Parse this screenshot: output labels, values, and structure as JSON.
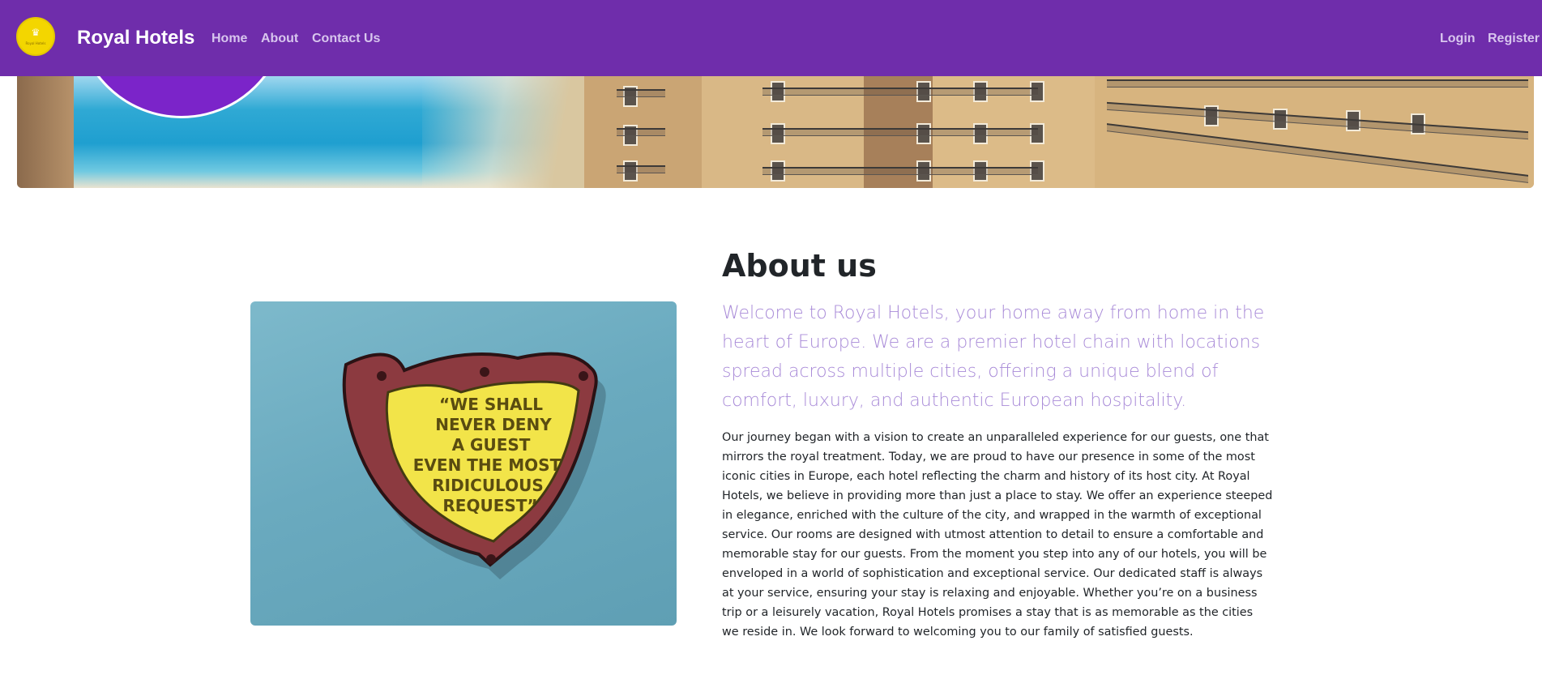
{
  "navbar": {
    "logo_text": "Royal Hotels",
    "brand": "Royal Hotels",
    "links": [
      "Home",
      "About",
      "Contact Us"
    ],
    "auth": {
      "login": "Login",
      "register": "Register"
    },
    "colors": {
      "bar": "#6f2dab",
      "link": "#d8c6ee",
      "logo": "#f3d600"
    }
  },
  "hero": {
    "image": "hotel-beachfront-banner"
  },
  "about": {
    "title": "About us",
    "lead": "Welcome to Royal Hotels, your home away from home in the heart of Europe. We are a premier hotel chain with locations spread across multiple cities, offering a unique blend of comfort, luxury, and authentic European hospitality.",
    "body": "Our journey began with a vision to create an unparalleled experience for our guests, one that mirrors the royal treatment. Today, we are proud to have our presence in some of the most iconic cities in Europe, each hotel reflecting the charm and history of its host city. At Royal Hotels, we believe in providing more than just a place to stay. We offer an experience steeped in elegance, enriched with the culture of the city, and wrapped in the warmth of exceptional service. Our rooms are designed with utmost attention to detail to ensure a comfortable and memorable stay for our guests. From the moment you step into any of our hotels, you will be enveloped in a world of sophistication and exceptional service. Our dedicated staff is always at your service, ensuring your stay is relaxing and enjoyable. Whether you’re on a business trip or a leisurely vacation, Royal Hotels promises a stay that is as memorable as the cities we reside in. We look forward to welcoming you to our family of satisfied guests.",
    "plaque_text": [
      "“WE SHALL",
      "NEVER DENY",
      "A GUEST",
      "EVEN THE MOST",
      "RIDICULOUS",
      "REQUEST”"
    ],
    "lead_color": "#a98bd8"
  }
}
